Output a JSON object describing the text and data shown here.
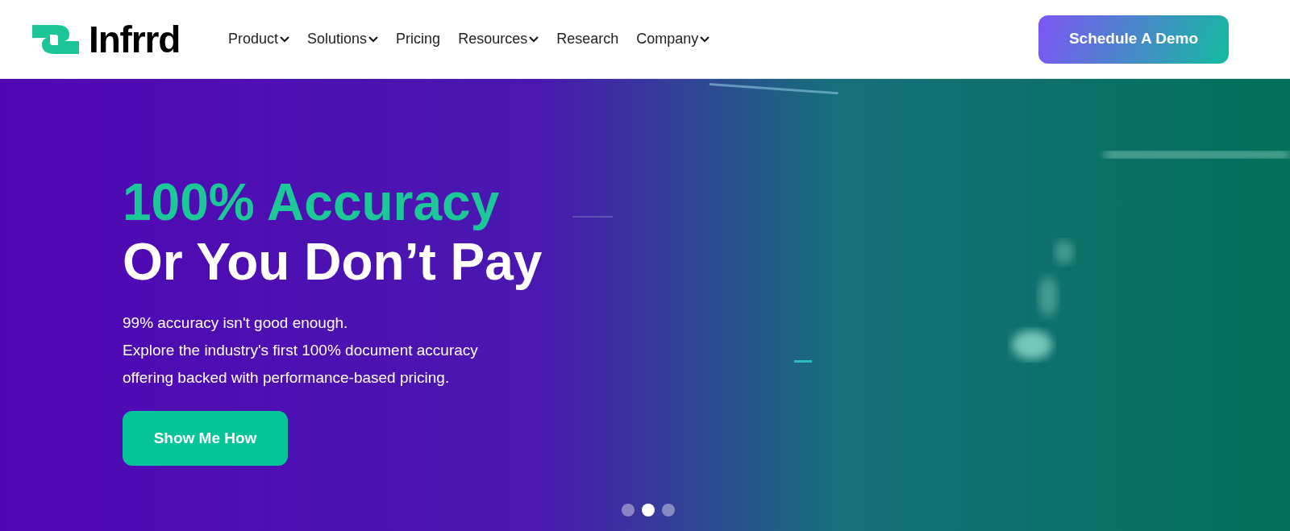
{
  "logo": {
    "text": "Infrrd"
  },
  "nav": [
    {
      "label": "Product",
      "dropdown": true
    },
    {
      "label": "Solutions",
      "dropdown": true
    },
    {
      "label": "Pricing",
      "dropdown": false
    },
    {
      "label": "Resources",
      "dropdown": true
    },
    {
      "label": "Research",
      "dropdown": false
    },
    {
      "label": "Company",
      "dropdown": true
    }
  ],
  "cta": "Schedule A Demo",
  "hero": {
    "kind": "picture",
    "headline_accent": "100% Accuracy",
    "headline": "Or You Don’t Pay",
    "lines": [
      "99% accuracy isn't good enough.",
      "Explore the industry's first 100% document accuracy",
      "offering backed with performance-based pricing."
    ],
    "button": "Show Me How"
  },
  "slides": [
    {
      "selected": false
    },
    {
      "selected": true
    },
    {
      "selected": false
    }
  ]
}
